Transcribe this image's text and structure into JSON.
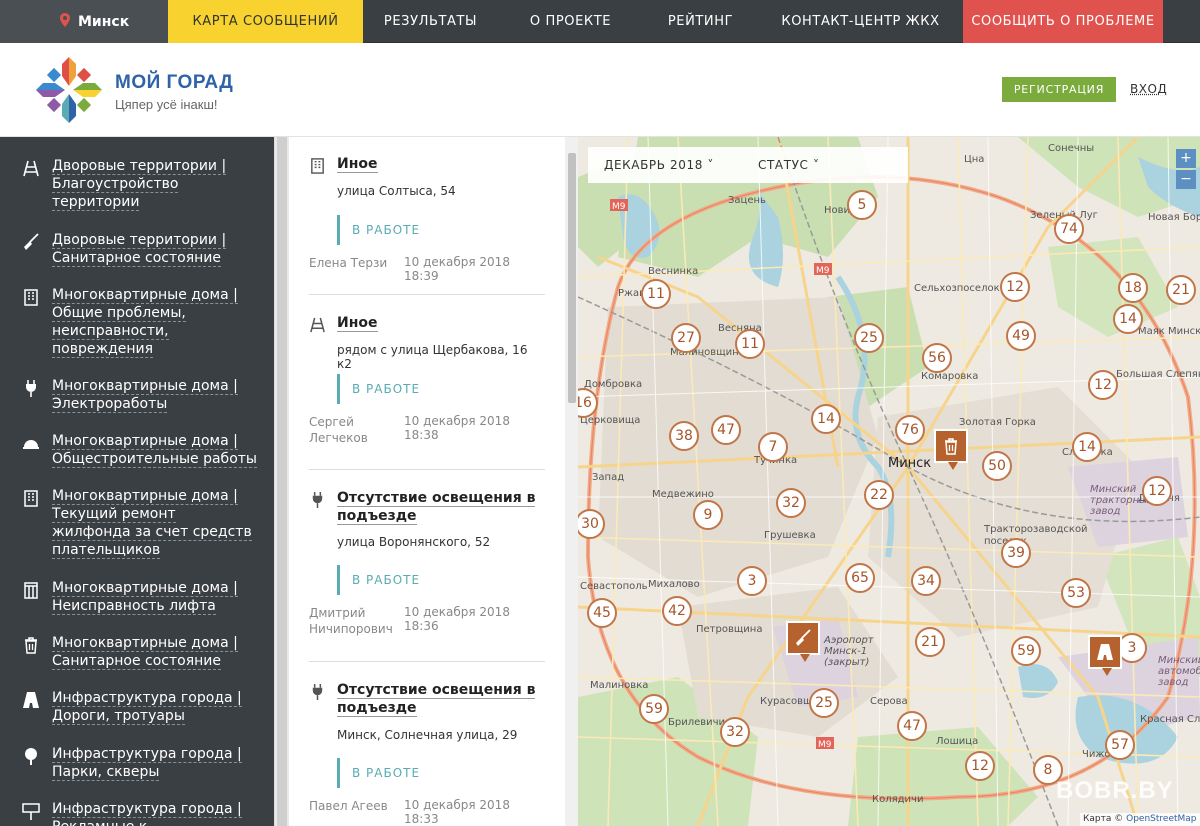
{
  "topnav": {
    "city": "Минск",
    "items": [
      "Карта сообщений",
      "Результаты",
      "О проекте",
      "Рейтинг",
      "Контакт-центр ЖКХ",
      "Сообщить о проблеме"
    ]
  },
  "header": {
    "brand_title": "МОЙ ГОРАД",
    "brand_sub": "Цяпер усё інакш!",
    "register_label": "Регистрация",
    "login_label": "ВХОД"
  },
  "colors": {
    "accent": "#f8d22e",
    "alert": "#e0524d",
    "register": "#7aab3c",
    "status": "#5aabb4",
    "cluster_border": "#c27648",
    "sidebar_bg": "#3a3f43"
  },
  "sidebar": {
    "categories": [
      {
        "icon": "road-sign-icon",
        "label": "Дворовые территории | Благоустройство территории"
      },
      {
        "icon": "broom-icon",
        "label": "Дворовые территории | Санитарное состояние"
      },
      {
        "icon": "building-icon",
        "label": "Многоквартирные дома | Общие проблемы, неисправности, повреждения"
      },
      {
        "icon": "plug-icon",
        "label": "Многоквартирные дома | Электроработы"
      },
      {
        "icon": "helmet-icon",
        "label": "Многоквартирные дома | Общестроительные работы"
      },
      {
        "icon": "building-icon",
        "label": "Многоквартирные дома | Текущий ремонт жилфонда за счет средств плательщиков"
      },
      {
        "icon": "elevator-icon",
        "label": "Многоквартирные дома | Неисправность лифта"
      },
      {
        "icon": "trash-icon",
        "label": "Многоквартирные дома | Санитарное состояние"
      },
      {
        "icon": "road-icon",
        "label": "Инфраструктура города | Дороги, тротуары"
      },
      {
        "icon": "tree-icon",
        "label": "Инфраструктура города | Парки, скверы"
      },
      {
        "icon": "billboard-icon",
        "label": "Инфраструктура города | Рекламные к..."
      }
    ]
  },
  "messages": [
    {
      "icon": "building-icon",
      "title": "Иное",
      "address": "улица Солтыса, 54",
      "status": "В работе",
      "author": "Елена Терзи",
      "date": "10 декабря 2018 18:39"
    },
    {
      "icon": "road-sign-icon",
      "title": "Иное",
      "address": "рядом с улица Щербакова, 16 к2",
      "status": "В работе",
      "author": "Сергей Легчеков",
      "date": "10 декабря 2018 18:38"
    },
    {
      "icon": "plug-icon",
      "title": "Отсутствие освещения в подъезде",
      "address": "улица Воронянского, 52",
      "status": "В работе",
      "author": "Дмитрий Ничипорович",
      "date": "10 декабря 2018 18:36"
    },
    {
      "icon": "plug-icon",
      "title": "Отсутствие освещения в подъезде",
      "address": "Минск, Солнечная улица, 29",
      "status": "В работе",
      "author": "Павел Агеев",
      "date": "10 декабря 2018 18:33"
    }
  ],
  "map": {
    "filter_month": "Декабрь 2018",
    "filter_status": "Статус",
    "zoom_in": "+",
    "zoom_out": "−",
    "city_label": "Минск",
    "labels": [
      "Зацень",
      "Новинки",
      "Веснинка",
      "Ржавка",
      "Сельхозпоселок",
      "Зеленый Луг",
      "Цна",
      "Сонечны",
      "Новая Борови",
      "Маяк Минска",
      "Большая Слепянка",
      "Весняна",
      "Малиновщина",
      "Домбровка",
      "Комаровка",
      "Золотая Горка",
      "Тучинка",
      "Медвежино",
      "Запад",
      "Грушевка",
      "Тракторозаводской поселок",
      "Михалово",
      "Петровщина",
      "Аэропорт Минск-1 (закрыт)",
      "Курасовщина",
      "Серова",
      "Брилевичи",
      "Малиновка",
      "Лошица",
      "Чижовка",
      "Красная Слобода",
      "Минский тракторный завод",
      "Минский автомобильный завод",
      "Колядичи",
      "Слепянка",
      "Дражня",
      "Севастополь",
      "Церковища"
    ],
    "clusters": [
      5,
      74,
      12,
      18,
      21,
      11,
      11,
      27,
      25,
      56,
      49,
      14,
      12,
      16,
      38,
      47,
      7,
      14,
      76,
      50,
      14,
      9,
      32,
      22,
      12,
      30,
      39,
      3,
      65,
      34,
      53,
      45,
      42,
      21,
      59,
      3,
      59,
      25,
      47,
      32,
      12,
      8,
      57
    ],
    "attribution_prefix": "Карта ©",
    "attribution_link": "OpenStreetMap",
    "watermark": "BOBR.BY"
  }
}
